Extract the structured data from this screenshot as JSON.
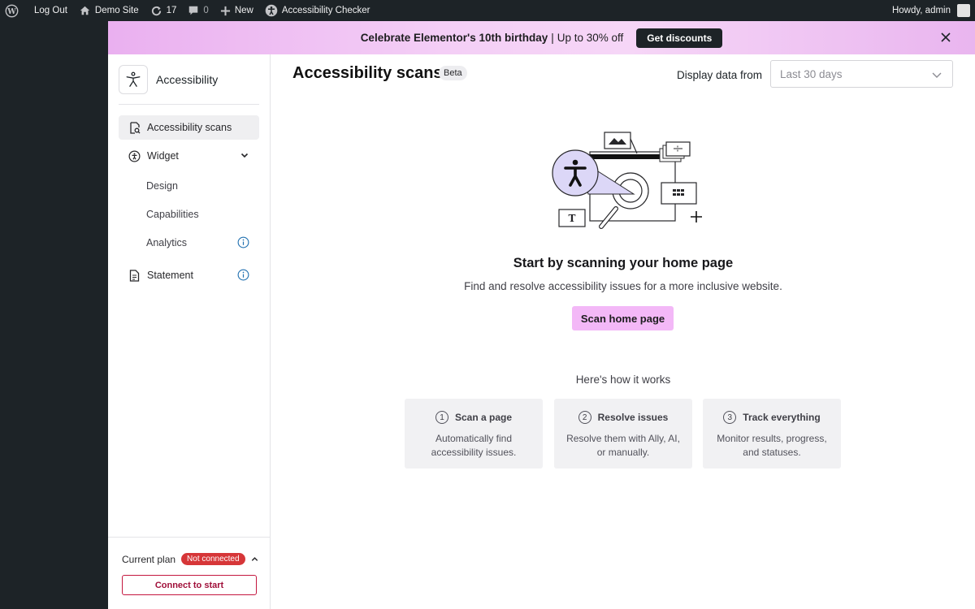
{
  "admin_bar": {
    "logout": "Log Out",
    "site": "Demo Site",
    "updates": "17",
    "comments": "0",
    "new": "New",
    "plugin": "Accessibility Checker",
    "howdy": "Howdy, admin"
  },
  "promo": {
    "headline": "Celebrate Elementor's 10th birthday",
    "separator": "|",
    "offer": "Up to 30% off",
    "cta": "Get discounts"
  },
  "sidebar": {
    "brand": "Accessibility",
    "items": [
      {
        "label": "Accessibility scans"
      },
      {
        "label": "Widget"
      },
      {
        "label": "Design"
      },
      {
        "label": "Capabilities"
      },
      {
        "label": "Analytics"
      },
      {
        "label": "Statement"
      }
    ],
    "plan_label": "Current plan",
    "plan_status": "Not connected",
    "connect": "Connect to start"
  },
  "main": {
    "title": "Accessibility scans",
    "badge": "Beta",
    "display_label": "Display data from",
    "date_range": "Last 30 days",
    "empty_title": "Start by scanning your home page",
    "empty_desc": "Find and resolve accessibility issues for a more inclusive website.",
    "scan_button": "Scan home page",
    "how_title": "Here's how it works",
    "steps": [
      {
        "num": "1",
        "title": "Scan a page",
        "desc": "Automatically find accessibility issues."
      },
      {
        "num": "2",
        "title": "Resolve issues",
        "desc": "Resolve them with Ally, AI, or manually."
      },
      {
        "num": "3",
        "title": "Track everything",
        "desc": "Monitor results, progress, and statuses."
      }
    ]
  },
  "colors": {
    "admin_bar": "#1d2327",
    "scan_button": "#f3b8f7",
    "not_connected": "#d63638",
    "connect_border": "#c4173f"
  },
  "icons": [
    "wordpress-logo-icon",
    "home-icon",
    "updates-icon",
    "comment-icon",
    "plus-icon",
    "accessibility-icon",
    "close-icon",
    "scan-doc-icon",
    "widget-icon",
    "chevron-down-icon",
    "info-icon",
    "document-icon",
    "chevron-up-icon"
  ]
}
